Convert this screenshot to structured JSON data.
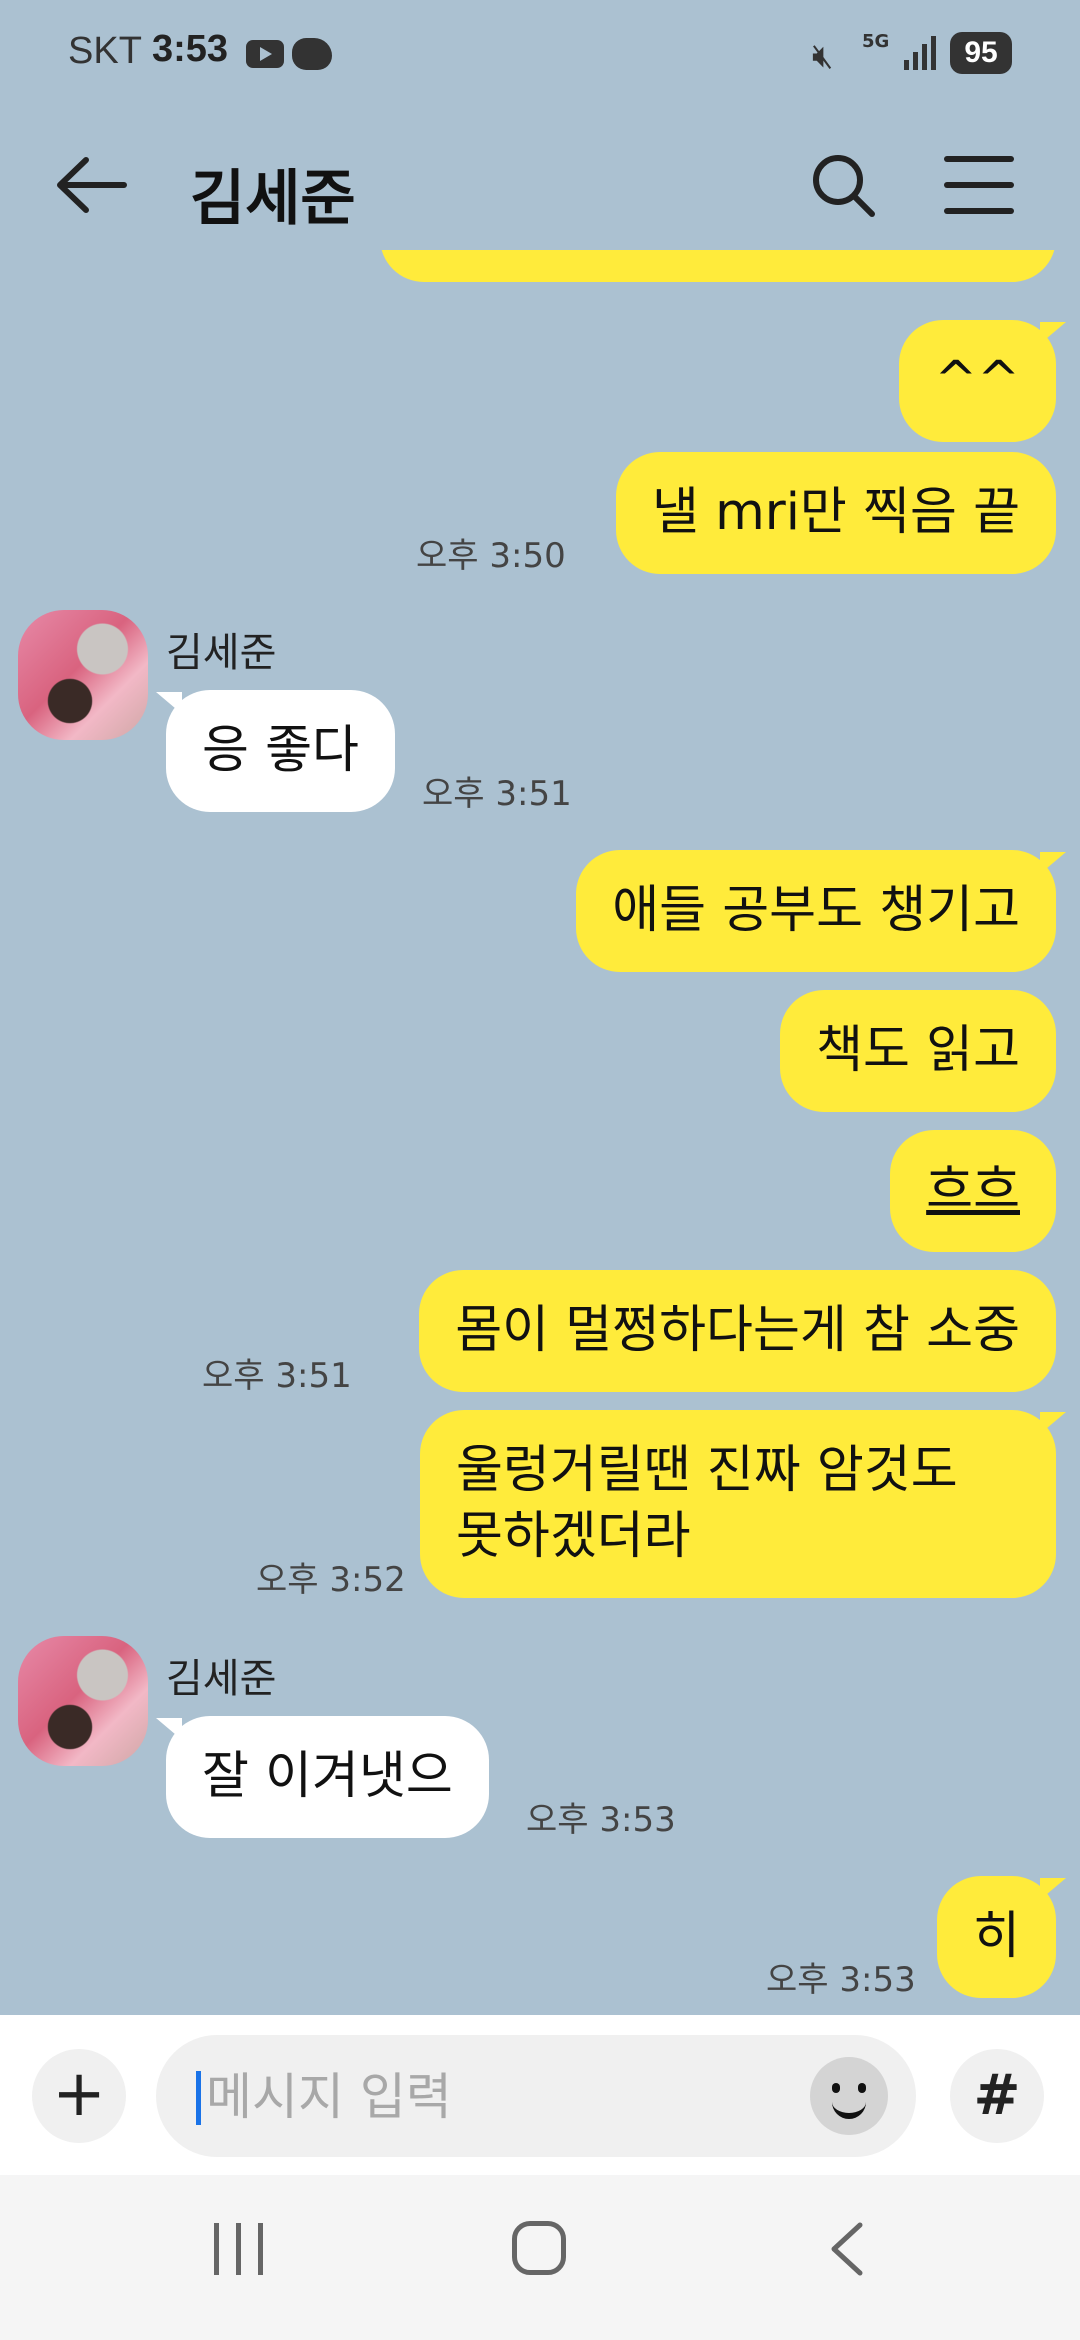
{
  "status": {
    "carrier": "SKT",
    "time": "3:53",
    "network": "5G",
    "battery": "95"
  },
  "header": {
    "title": "김세준"
  },
  "messages": [
    {
      "type": "sent",
      "text": "^^"
    },
    {
      "type": "sent",
      "text": "낼 mri만 찍음 끝",
      "time": "오후 3:50"
    },
    {
      "type": "sender",
      "name": "김세준"
    },
    {
      "type": "recv",
      "text": "응 좋다",
      "time": "오후 3:51"
    },
    {
      "type": "sent",
      "text": "애들 공부도 챙기고"
    },
    {
      "type": "sent",
      "text": "책도 읽고"
    },
    {
      "type": "sent",
      "text": "흐흐"
    },
    {
      "type": "sent",
      "text": "몸이 멀쩡하다는게 참 소중",
      "time": "오후 3:51"
    },
    {
      "type": "sent",
      "text_line1": "울렁거릴땐 진짜 암것도",
      "text_line2": "못하겠더라",
      "time": "오후 3:52"
    },
    {
      "type": "sender",
      "name": "김세준"
    },
    {
      "type": "recv",
      "text": "잘 이겨냇으",
      "time": "오후 3:53"
    },
    {
      "type": "sent",
      "text": "히",
      "time": "오후 3:53"
    }
  ],
  "input": {
    "placeholder": "메시지 입력"
  },
  "icons": {
    "back": "arrow-left-icon",
    "search": "search-icon",
    "menu": "hamburger-menu-icon",
    "plus": "plus-icon",
    "emoji": "emoji-icon",
    "hash": "hash-icon"
  },
  "colors": {
    "background": "#abc1d1",
    "sent_bubble": "#ffeb3b",
    "recv_bubble": "#ffffff"
  }
}
